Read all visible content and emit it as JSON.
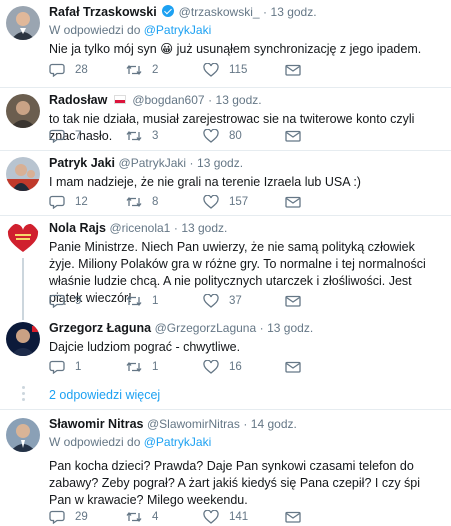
{
  "tweets": [
    {
      "name": "Rafał Trzaskowski",
      "verified": true,
      "handle": "@trzaskowski_",
      "time": "13 godz.",
      "reply_to_prefix": "W odpowiedzi do",
      "reply_to_user": "@PatrykJaki",
      "text": "Nie ja tylko mój syn 😀 już usunąłem synchronizację z jego ipadem.",
      "replies": "28",
      "retweets": "2",
      "likes": "115"
    },
    {
      "name": "Radosław",
      "handle": "@bogdan607",
      "time": "13 godz.",
      "text": "to tak nie działa, musiał zarejestrowac sie na twiterowe konto czyli znac hasło.",
      "replies": "7",
      "retweets": "3",
      "likes": "80"
    },
    {
      "name": "Patryk Jaki",
      "handle": "@PatrykJaki",
      "time": "13 godz.",
      "text": "I mam nadzieje, że nie grali na terenie Izraela lub USA :)",
      "replies": "12",
      "retweets": "8",
      "likes": "157"
    },
    {
      "name": "Nola Rajs",
      "handle": "@ricenola1",
      "time": "13 godz.",
      "text": "Panie Ministrze. Niech Pan uwierzy, że nie samą polityką człowiek żyje. Miliony Polaków gra w różne gry. To normalne i tej normalności właśnie ludzie chcą. A nie politycznych utarczek i złośliwości. Jest piątek wieczór!",
      "replies": "9",
      "retweets": "1",
      "likes": "37"
    },
    {
      "name": "Grzegorz Łaguna",
      "handle": "@GrzegorzLaguna",
      "time": "13 godz.",
      "text": "Dajcie ludziom pograć - chwytliwe.",
      "replies": "1",
      "retweets": "1",
      "likes": "16"
    },
    {
      "name": "Sławomir Nitras",
      "handle": "@SlawomirNitras",
      "time": "14 godz.",
      "reply_to_prefix": "W odpowiedzi do",
      "reply_to_user": "@PatrykJaki",
      "text": "Pan kocha dzieci? Prawda? Daje Pan synkowi czasami telefon do zabawy? Zeby pograł? A żart jakiś kiedyś się Pana czepił? I czy śpi Pan w krawacie? Milego weekendu.",
      "replies": "29",
      "retweets": "4",
      "likes": "141"
    }
  ],
  "more_replies": "2 odpowiedzi więcej",
  "colors": {
    "accent": "#1da1f2",
    "muted": "#657786",
    "text": "#14171a",
    "divider": "#e6ecf0"
  },
  "icons": [
    "reply-icon",
    "retweet-icon",
    "like-icon",
    "message-icon",
    "verified-icon",
    "chevron-down-icon"
  ]
}
